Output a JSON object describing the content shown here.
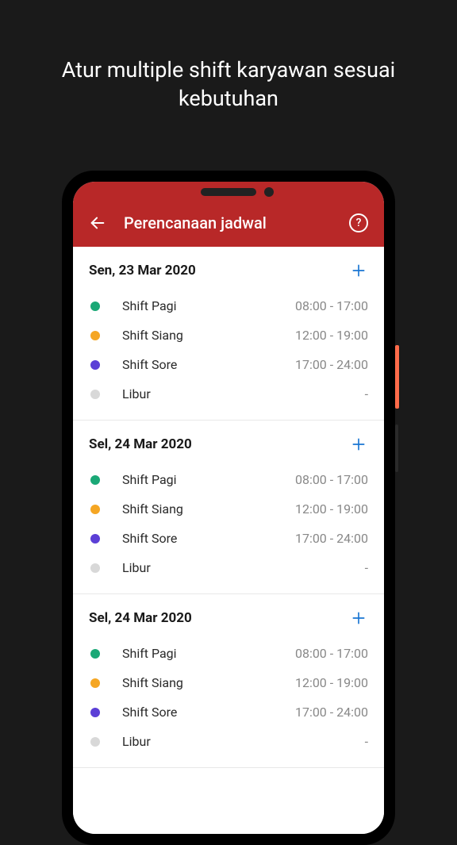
{
  "headline": "Atur multiple shift karyawan sesuai kebutuhan",
  "header": {
    "title": "Perencanaan jadwal",
    "help_label": "?"
  },
  "colors": {
    "green": "#1aa876",
    "orange": "#f5a623",
    "purple": "#5b3fd6",
    "grey": "#d8d8d8"
  },
  "days": [
    {
      "date": "Sen, 23 Mar 2020",
      "shifts": [
        {
          "color": "green",
          "name": "Shift Pagi",
          "time": "08:00 - 17:00"
        },
        {
          "color": "orange",
          "name": "Shift Siang",
          "time": "12:00 - 19:00"
        },
        {
          "color": "purple",
          "name": "Shift Sore",
          "time": "17:00 - 24:00"
        },
        {
          "color": "grey",
          "name": "Libur",
          "time": "-"
        }
      ]
    },
    {
      "date": "Sel, 24 Mar 2020",
      "shifts": [
        {
          "color": "green",
          "name": "Shift Pagi",
          "time": "08:00 - 17:00"
        },
        {
          "color": "orange",
          "name": "Shift Siang",
          "time": "12:00 - 19:00"
        },
        {
          "color": "purple",
          "name": "Shift Sore",
          "time": "17:00 - 24:00"
        },
        {
          "color": "grey",
          "name": "Libur",
          "time": "-"
        }
      ]
    },
    {
      "date": "Sel, 24 Mar 2020",
      "shifts": [
        {
          "color": "green",
          "name": "Shift Pagi",
          "time": "08:00 - 17:00"
        },
        {
          "color": "orange",
          "name": "Shift Siang",
          "time": "12:00 - 19:00"
        },
        {
          "color": "purple",
          "name": "Shift Sore",
          "time": "17:00 - 24:00"
        },
        {
          "color": "grey",
          "name": "Libur",
          "time": "-"
        }
      ]
    }
  ]
}
